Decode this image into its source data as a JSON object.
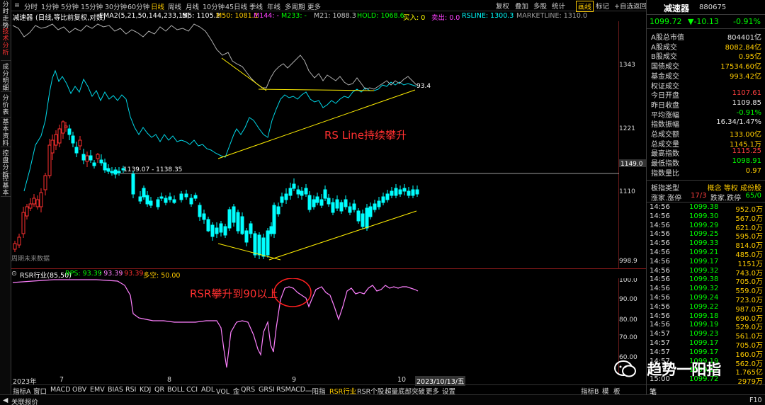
{
  "left_tabs": [
    "分时走势",
    "技术分析",
    "成分明细",
    "分价表",
    "基本资料",
    "控盘分析",
    "控基本"
  ],
  "toolbar": {
    "periods": [
      "分时",
      "1分钟",
      "5分钟",
      "15分钟",
      "30分钟",
      "60分钟",
      "日线",
      "周线",
      "月线",
      "10分钟",
      "45日线",
      "季线",
      "年线",
      "多周期",
      "更多"
    ],
    "active_period": "日线",
    "right_buttons": [
      "复权",
      "叠加",
      "多股",
      "统计",
      "画线",
      "标记",
      "+自选",
      "返回"
    ]
  },
  "indicator_line": {
    "name": "减速器",
    "params": "(日线,等比前复权,对数)",
    "ema": "EMA2(5,21,50,144,233,15)",
    "items": [
      {
        "label": "M5: 1105.2",
        "color": "#ffffff"
      },
      {
        "label": "M50: 1081.1",
        "color": "#ffcc00"
      },
      {
        "label": "M144: -",
        "color": "#ff40ff"
      },
      {
        "label": "M233: -",
        "color": "#00ff00"
      },
      {
        "label": "M21: 1088.3",
        "color": "#c8c8c8"
      },
      {
        "label": "HOLD: 1068.6",
        "color": "#00ff00"
      },
      {
        "label": "买入: 0",
        "color": "#ffff00"
      },
      {
        "label": "卖出: 0.0",
        "color": "#ff40ff"
      },
      {
        "label": "RSLINE: 1300.3",
        "color": "#00ffff"
      },
      {
        "label": "MARKETLINE: 1310.0",
        "color": "#a0a0a0"
      }
    ]
  },
  "price_axis": [
    "1343",
    "1221",
    "1149.0",
    "1110",
    "998.9"
  ],
  "price_tags": {
    "high_label": "1139.07 - 1138.35",
    "rs_end": "93.4",
    "low_note": "周期未来数据"
  },
  "annotations": {
    "rs_line": "RS Line持续攀升",
    "rsr": "RSR攀升到90以上"
  },
  "rsr_header": {
    "name": "RSR行业(85,50)",
    "items": [
      {
        "label": "RPS: 93.39",
        "color": "#00ff00"
      },
      {
        "label": ": 93.39",
        "color": "#ff80ff"
      },
      {
        "label": ": 93.39",
        "color": "#ff3030"
      },
      {
        "label": "多空: 50.00",
        "color": "#ffcc00"
      }
    ]
  },
  "rsr_axis": [
    "100.0",
    "90.00",
    "80.00",
    "70.00",
    "60.00"
  ],
  "date_axis": [
    "2023年",
    "7",
    "8",
    "9",
    "10"
  ],
  "date_cursor": "2023/10/13/五",
  "bottom_tabs": [
    "指标A",
    "窗口",
    "MACD",
    "OBV",
    "EMV",
    "BIAS",
    "RSI",
    "KDJ",
    "QR",
    "BOLL",
    "CCI",
    "ADL",
    "VOL_金",
    "QRS",
    "GRSI",
    "RSMACD",
    "一阳指",
    "RSR行业",
    "RSR个股",
    "超量底部突破",
    "更多",
    "设置"
  ],
  "active_bottom_tab": "RSR行业",
  "bottom_right": [
    "指标B",
    "模",
    "板"
  ],
  "status": {
    "left": "关联报价",
    "right": "F10"
  },
  "quote": {
    "name": "减速器",
    "code": "880675",
    "price": "1099.72",
    "change": "▼-10.13",
    "pct": "-0.91%",
    "rows": [
      {
        "label": "A股总市值",
        "value": "804401亿",
        "color": "#e8e8e8"
      },
      {
        "label": "A股成交",
        "value": "8082.84亿",
        "color": "#ffcc00"
      },
      {
        "label": "B股成交",
        "value": "0.95亿",
        "color": "#ffcc00"
      },
      {
        "label": "国债成交",
        "value": "17534.60亿",
        "color": "#ffcc00"
      },
      {
        "label": "基金成交",
        "value": "993.42亿",
        "color": "#ffcc00"
      },
      {
        "label": "权证成交",
        "value": "",
        "color": "#ffcc00"
      },
      {
        "label": "今日开盘",
        "value": "1107.61",
        "color": "#ff4040"
      },
      {
        "label": "昨日收盘",
        "value": "1109.85",
        "color": "#e8e8e8"
      },
      {
        "label": "平均涨幅",
        "value": "-0.91%",
        "color": "#00ff00"
      },
      {
        "label": "指数振幅",
        "value": "16.34/1.47%",
        "color": "#e8e8e8"
      },
      {
        "label": "总成交额",
        "value": "133.00亿",
        "color": "#ffcc00"
      },
      {
        "label": "总成交量",
        "value": "1145.1万",
        "color": "#ffcc00"
      },
      {
        "label": "最高指数",
        "value": "1115.25",
        "color": "#ff4040"
      },
      {
        "label": "最低指数",
        "value": "1098.91",
        "color": "#00ff00"
      },
      {
        "label": "指数量比",
        "value": "0.97",
        "color": "#ffcc00"
      }
    ],
    "board": {
      "label": "板指类型",
      "tags": "概念 等权 成份股"
    },
    "updown": {
      "label": "涨家.涨停",
      "up": "17/3",
      "label2": "跌家.跌停",
      "down": "65/0"
    }
  },
  "ticks": [
    {
      "t": "14:56",
      "p": "1099.38",
      "v": "952.0万"
    },
    {
      "t": "14:56",
      "p": "1099.30",
      "v": "567.0万"
    },
    {
      "t": "14:56",
      "p": "1099.29",
      "v": "621.0万"
    },
    {
      "t": "14:56",
      "p": "1099.25",
      "v": "595.0万"
    },
    {
      "t": "14:56",
      "p": "1099.33",
      "v": "814.0万"
    },
    {
      "t": "14:56",
      "p": "1099.21",
      "v": "485.0万"
    },
    {
      "t": "14:56",
      "p": "1099.17",
      "v": "1151万"
    },
    {
      "t": "14:56",
      "p": "1099.32",
      "v": "743.0万"
    },
    {
      "t": "14:56",
      "p": "1099.38",
      "v": "705.0万"
    },
    {
      "t": "14:56",
      "p": "1099.32",
      "v": "559.0万"
    },
    {
      "t": "14:56",
      "p": "1099.24",
      "v": "723.0万"
    },
    {
      "t": "14:56",
      "p": "1099.22",
      "v": "987.0万"
    },
    {
      "t": "14:56",
      "p": "1099.18",
      "v": "690.0万"
    },
    {
      "t": "14:56",
      "p": "1099.19",
      "v": "529.0万"
    },
    {
      "t": "14:57",
      "p": "1099.23",
      "v": "561.0万"
    },
    {
      "t": "14:57",
      "p": "1099.17",
      "v": "705.0万"
    },
    {
      "t": "14:57",
      "p": "1099.17",
      "v": "160.0万"
    },
    {
      "t": "14:57",
      "p": "1099.19",
      "v": "562.0万"
    },
    {
      "t": "",
      "p": "1099.17",
      "v": "1.765亿"
    },
    {
      "t": "15:00",
      "p": "1099.72",
      "v": "2979万"
    }
  ],
  "tick_tab": "笔",
  "watermark": "趋势一阳指",
  "colors": {
    "up": "#ff3030",
    "down": "#00ffff",
    "ma": "#ffff00",
    "rsline": "#00ffff",
    "marketline": "#a0a0a0",
    "rsr": "#ff80ff"
  }
}
